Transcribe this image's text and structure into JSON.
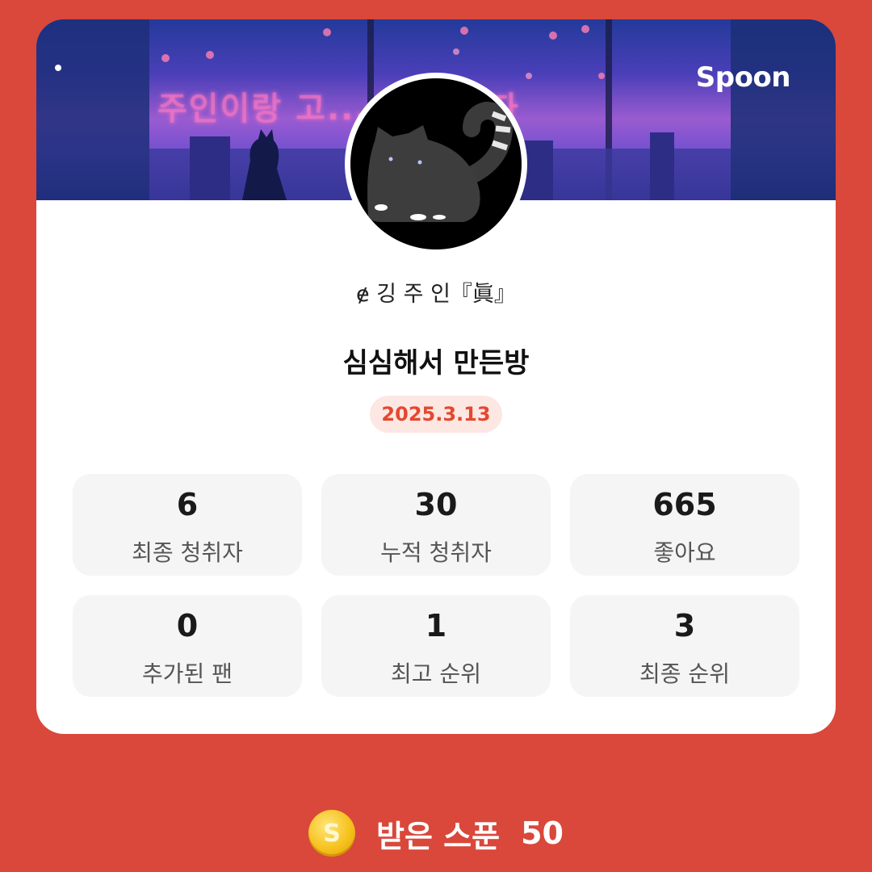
{
  "banner": {
    "overlay_text": "주인이랑 고... 같이 있자",
    "brand": "Spoon"
  },
  "profile": {
    "nickname": "ɇ 깅 주 인『眞』"
  },
  "room": {
    "title": "심심해서 만든방",
    "date": "2025.3.13"
  },
  "stats": [
    {
      "value": "6",
      "label": "최종 청취자"
    },
    {
      "value": "30",
      "label": "누적 청취자"
    },
    {
      "value": "665",
      "label": "좋아요"
    },
    {
      "value": "0",
      "label": "추가된 팬"
    },
    {
      "value": "1",
      "label": "최고 순위"
    },
    {
      "value": "3",
      "label": "최종 순위"
    }
  ],
  "footer": {
    "coin_symbol": "S",
    "label": "받은 스푼",
    "value": "50"
  },
  "colors": {
    "background": "#d9483b",
    "accent": "#e4482f",
    "badge_bg": "#fde7e3",
    "tile_bg": "#f5f5f5"
  }
}
